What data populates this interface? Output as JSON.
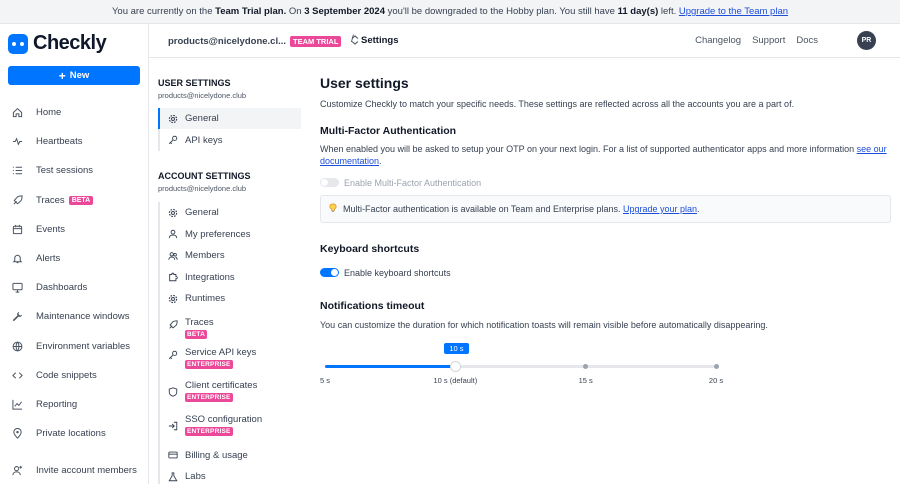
{
  "banner": {
    "text1": "You are currently on the ",
    "plan": "Team Trial plan.",
    "text2": " On ",
    "date": "3 September 2024",
    "text3": " you'll be downgraded to the Hobby plan. You still have ",
    "days": "11 day(s)",
    "text4": " left. ",
    "link": "Upgrade to the Team plan"
  },
  "logo": {
    "text": "Checkly"
  },
  "new_button": {
    "label": "New",
    "icon": "plus-icon"
  },
  "nav": {
    "items": [
      {
        "label": "Home",
        "icon": "home-icon"
      },
      {
        "label": "Heartbeats",
        "icon": "heartbeat-icon"
      },
      {
        "label": "Test sessions",
        "icon": "list-icon"
      },
      {
        "label": "Traces",
        "icon": "rocket-icon",
        "badge": "BETA"
      },
      {
        "label": "Events",
        "icon": "calendar-icon"
      },
      {
        "label": "Alerts",
        "icon": "bell-icon"
      },
      {
        "label": "Dashboards",
        "icon": "monitor-icon"
      },
      {
        "label": "Maintenance windows",
        "icon": "wrench-icon"
      },
      {
        "label": "Environment variables",
        "icon": "globe-icon"
      },
      {
        "label": "Code snippets",
        "icon": "code-icon"
      },
      {
        "label": "Reporting",
        "icon": "chart-icon"
      },
      {
        "label": "Private locations",
        "icon": "location-icon"
      },
      {
        "label": "Invite account members",
        "icon": "user-plus-icon"
      }
    ]
  },
  "topbar": {
    "account": "products@nicelydone.cl...",
    "trial_badge": "TEAM TRIAL",
    "separator": "/",
    "breadcrumb": "Settings",
    "links": [
      "Changelog",
      "Support",
      "Docs"
    ],
    "avatar": "PR"
  },
  "settings_nav": {
    "user_heading": "USER SETTINGS",
    "user_email": "products@nicelydone.club",
    "user_items": [
      {
        "label": "General",
        "icon": "gear-icon"
      },
      {
        "label": "API keys",
        "icon": "key-icon"
      }
    ],
    "account_heading": "ACCOUNT SETTINGS",
    "account_email": "products@nicelydone.club",
    "account_items": [
      {
        "label": "General",
        "icon": "gear-icon"
      },
      {
        "label": "My preferences",
        "icon": "user-icon"
      },
      {
        "label": "Members",
        "icon": "users-icon"
      },
      {
        "label": "Integrations",
        "icon": "puzzle-icon"
      },
      {
        "label": "Runtimes",
        "icon": "gear-icon"
      },
      {
        "label": "Traces",
        "icon": "rocket-icon",
        "badge": "BETA"
      },
      {
        "label": "Service API keys",
        "icon": "key-icon",
        "badge": "ENTERPRISE"
      },
      {
        "label": "Client certificates",
        "icon": "shield-icon",
        "badge": "ENTERPRISE"
      },
      {
        "label": "SSO configuration",
        "icon": "login-icon",
        "badge": "ENTERPRISE"
      },
      {
        "label": "Billing & usage",
        "icon": "credit-card-icon"
      },
      {
        "label": "Labs",
        "icon": "flask-icon"
      }
    ]
  },
  "main": {
    "title": "User settings",
    "description": "Customize Checkly to match your specific needs. These settings are reflected across all the accounts you are a part of.",
    "mfa": {
      "heading": "Multi-Factor Authentication",
      "text": "When enabled you will be asked to setup your OTP on your next login. For a list of supported authenticator apps and more information ",
      "link1": "see our",
      "link2": "documentation",
      "period": ".",
      "toggle_label": "Enable Multi-Factor Authentication",
      "toggle_on": false,
      "info_icon": "lightbulb-icon",
      "info_text": "Multi-Factor authentication is available on Team and Enterprise plans. ",
      "info_link": "Upgrade your plan",
      "info_period": "."
    },
    "keyboard": {
      "heading": "Keyboard shortcuts",
      "toggle_label": "Enable keyboard shortcuts",
      "toggle_on": true
    },
    "notifications": {
      "heading": "Notifications timeout",
      "text": "You can customize the duration for which notification toasts will remain visible before automatically disappearing.",
      "slider_min": 5,
      "slider_max": 20,
      "slider_value": 10,
      "tooltip": "10 s",
      "ticks": [
        "5 s",
        "10 s (default)",
        "15 s",
        "20 s"
      ]
    }
  },
  "colors": {
    "accent": "#0075ff",
    "badge": "#ec4899"
  }
}
